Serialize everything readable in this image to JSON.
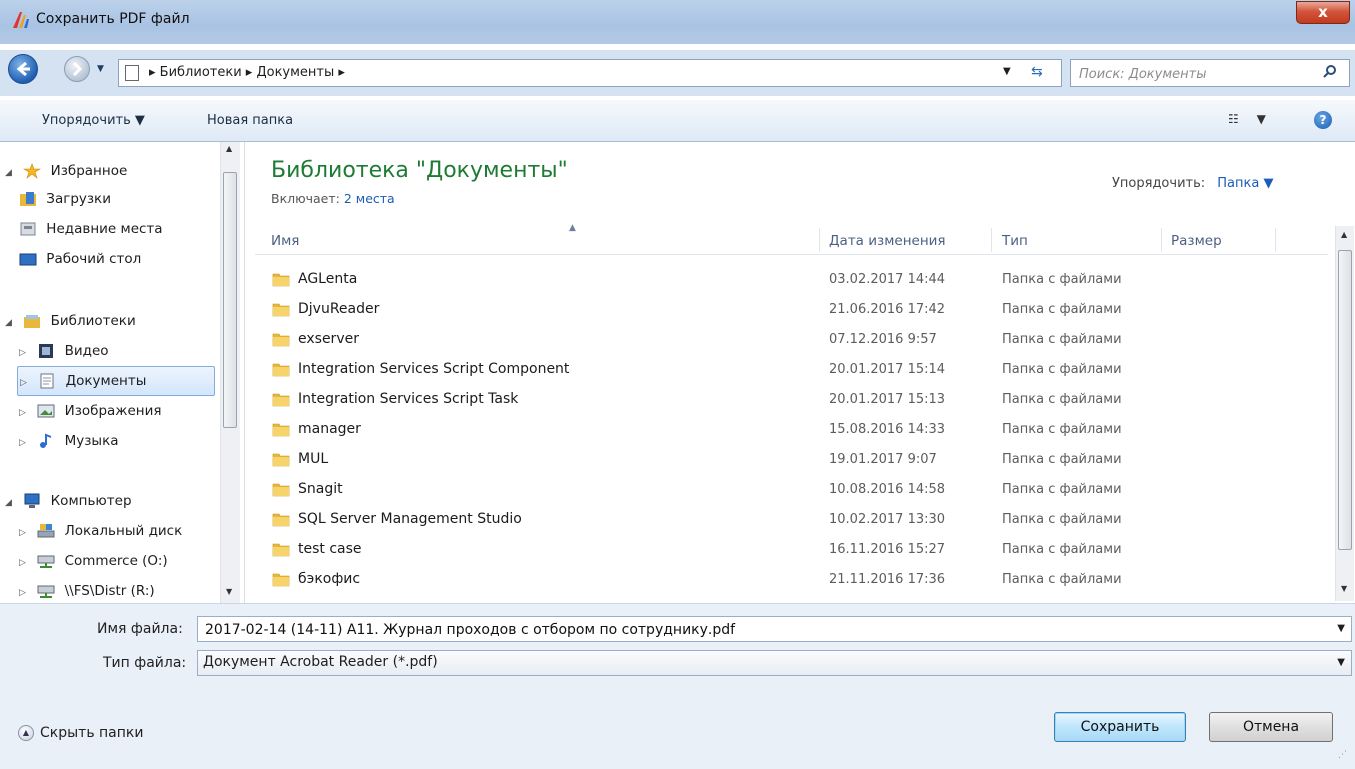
{
  "window": {
    "title": "Сохранить PDF файл",
    "close_label": "x"
  },
  "address": {
    "crumbs": [
      "Библиотеки",
      "Документы"
    ],
    "search_placeholder": "Поиск: Документы"
  },
  "toolbar": {
    "organize_label": "Упорядочить ▼",
    "new_folder_label": "Новая папка"
  },
  "nav": {
    "favorites": {
      "label": "Избранное",
      "items": [
        "Загрузки",
        "Недавние места",
        "Рабочий стол"
      ]
    },
    "libraries": {
      "label": "Библиотеки",
      "items": [
        "Видео",
        "Документы",
        "Изображения",
        "Музыка"
      ]
    },
    "computer": {
      "label": "Компьютер",
      "items": [
        "Локальный диск",
        "Commerce (O:)",
        "\\\\FS\\Distr (R:)"
      ]
    },
    "selected": "Документы"
  },
  "library": {
    "title": "Библиотека \"Документы\"",
    "includes_label": "Включает:",
    "includes_link": "2 места",
    "arrange_label": "Упорядочить:",
    "arrange_value": "Папка ▼"
  },
  "columns": {
    "name": "Имя",
    "date": "Дата изменения",
    "type": "Тип",
    "size": "Размер"
  },
  "files": [
    {
      "name": "AGLenta",
      "date": "03.02.2017 14:44",
      "type": "Папка с файлами"
    },
    {
      "name": "DjvuReader",
      "date": "21.06.2016 17:42",
      "type": "Папка с файлами"
    },
    {
      "name": "exserver",
      "date": "07.12.2016 9:57",
      "type": "Папка с файлами"
    },
    {
      "name": "Integration Services Script Component",
      "date": "20.01.2017 15:14",
      "type": "Папка с файлами"
    },
    {
      "name": "Integration Services Script Task",
      "date": "20.01.2017 15:13",
      "type": "Папка с файлами"
    },
    {
      "name": "manager",
      "date": "15.08.2016 14:33",
      "type": "Папка с файлами"
    },
    {
      "name": "MUL",
      "date": "19.01.2017 9:07",
      "type": "Папка с файлами"
    },
    {
      "name": "Snagit",
      "date": "10.08.2016 14:58",
      "type": "Папка с файлами"
    },
    {
      "name": "SQL Server Management Studio",
      "date": "10.02.2017 13:30",
      "type": "Папка с файлами"
    },
    {
      "name": "test case",
      "date": "16.11.2016 15:27",
      "type": "Папка с файлами"
    },
    {
      "name": "бэкофис",
      "date": "21.11.2016 17:36",
      "type": "Папка с файлами"
    }
  ],
  "bottom": {
    "filename_label": "Имя файла:",
    "filename_value": "2017-02-14 (14-11) A11. Журнал проходов с отбором по сотруднику.pdf",
    "filetype_label": "Тип файла:",
    "filetype_value": "Документ Acrobat Reader (*.pdf)",
    "hide_folders_label": "Скрыть папки",
    "save_label": "Сохранить",
    "cancel_label": "Отмена"
  },
  "colors": {
    "accent": "#1a5cb8",
    "library_title": "#1e7b35",
    "folder": "#e8b83a"
  }
}
